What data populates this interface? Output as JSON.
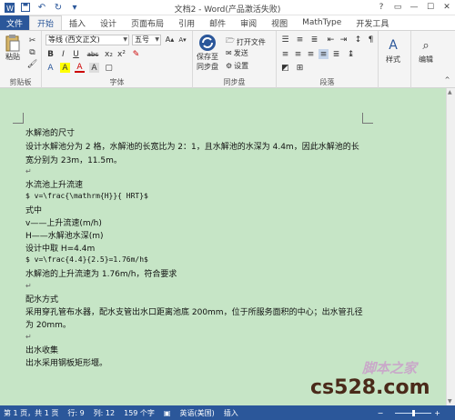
{
  "window": {
    "title": "文档2 - Word(产品激活失败)",
    "controls": [
      "?",
      "▭",
      "—",
      "☐",
      "✕"
    ]
  },
  "tabs": {
    "file": "文件",
    "items": [
      "开始",
      "插入",
      "设计",
      "页面布局",
      "引用",
      "邮件",
      "审阅",
      "视图",
      "MathType",
      "开发工具"
    ],
    "active": "开始"
  },
  "ribbon": {
    "clipboard": {
      "paste": "粘贴",
      "label": "剪贴板"
    },
    "font": {
      "font_name": "等线 (西文正文)",
      "font_size": "五号",
      "label": "字体",
      "buttons": [
        "B",
        "I",
        "U",
        "abc",
        "x₂",
        "x²",
        "A",
        "A",
        "A",
        "A"
      ]
    },
    "sync": {
      "save_to": "保存至",
      "sync_disk": "同步盘",
      "open_file": "打开文件",
      "send": "发送",
      "settings": "设置",
      "label": "同步盘"
    },
    "paragraph": {
      "label": "段落"
    },
    "styles": {
      "label": "样式"
    },
    "editing": {
      "label": "编辑"
    }
  },
  "document": {
    "l01": "水解池的尺寸",
    "l02": "设计水解池分为 2 格，水解池的长宽比为 2：1，且水解池的水深为 4.4m，因此水解池的长",
    "l03": "宽分别为 23m，11.5m。",
    "l05": "水流池上升流速",
    "l06": "$ v=\\frac{\\mathrm{H}}{ HRT}$",
    "l07": "式中",
    "l08": "v——上升流速(m/h)",
    "l09": "H——水解池水深(m)",
    "l10": "设计中取 H=4.4m",
    "l11": "$ v=\\frac{4.4}{2.5}=1.76m/h$",
    "l12": "水解池的上升流速为 1.76m/h，符合要求",
    "l14": "配水方式",
    "l15": "采用穿孔管布水器，配水支管出水口距离池底 200mm，位于所服务面积的中心；出水管孔径",
    "l16": "为 20mm。",
    "l18": "出水收集",
    "l19": "出水采用钢板矩形堰。"
  },
  "status": {
    "page": "第 1 页，共 1 页",
    "row": "行: 9",
    "col": "列: 12",
    "chars": "159 个字",
    "lang": "英语(美国)",
    "insert": "插入"
  },
  "watermark": {
    "site": "cs528.com",
    "brand": "脚本之家"
  },
  "colors": {
    "brand": "#2b579a",
    "document_bg": "#c6e5c6"
  }
}
